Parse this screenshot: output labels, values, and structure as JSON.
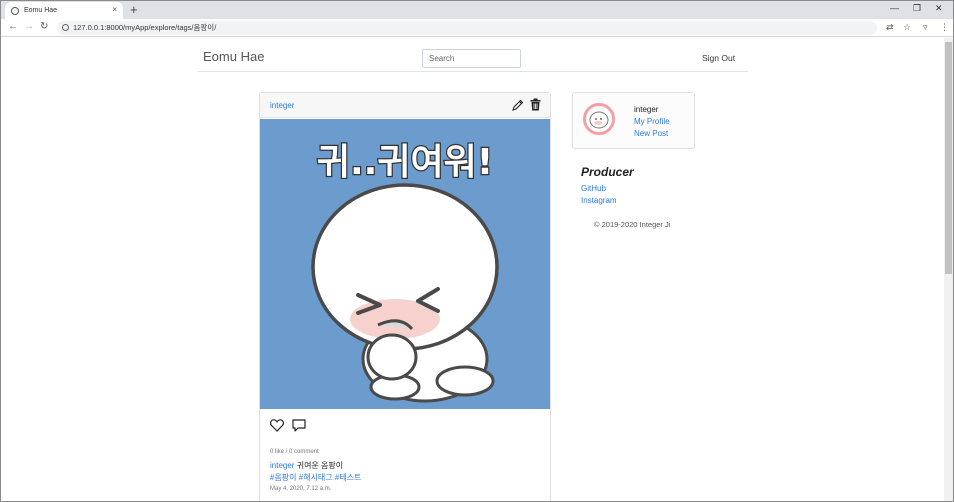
{
  "browser": {
    "tab_title": "Eomu Hae",
    "tab_close": "×",
    "new_tab": "+",
    "url": "127.0.0.1:8000/myApp/explore/tags/옴팡이/",
    "win_min": "—",
    "win_restore": "❐",
    "win_close": "✕"
  },
  "header": {
    "brand": "Eomu Hae",
    "search_placeholder": "Search",
    "signout": "Sign Out"
  },
  "post": {
    "author": "integer",
    "image_text": "귀..귀여워!",
    "stats": "0 like / 0 comment",
    "caption_user": "integer",
    "caption_text": "귀여운 옴팡이",
    "tags": [
      "#옴팡이",
      "#해시태그",
      "#테스트"
    ],
    "date": "May 4, 2020, 7:12 a.m."
  },
  "profile": {
    "name": "integer",
    "my_profile": "My Profile",
    "new_post": "New Post"
  },
  "sidebar": {
    "producer_title": "Producer",
    "github": "GitHub",
    "instagram": "Instagram",
    "copyright": "© 2019-2020 Integer Ji"
  },
  "icons": {
    "edit": "pencil-icon",
    "delete": "trash-icon",
    "like": "heart-icon",
    "comment": "comment-icon"
  },
  "colors": {
    "link": "#2a7ae2",
    "image_bg": "#6b9ccd",
    "avatar_ring": "#f2a0a6"
  }
}
